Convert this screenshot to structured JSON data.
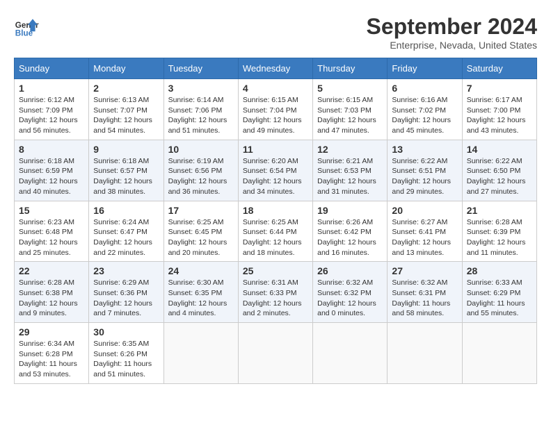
{
  "header": {
    "title": "September 2024",
    "subtitle": "Enterprise, Nevada, United States",
    "logo_line1": "General",
    "logo_line2": "Blue"
  },
  "days_of_week": [
    "Sunday",
    "Monday",
    "Tuesday",
    "Wednesday",
    "Thursday",
    "Friday",
    "Saturday"
  ],
  "weeks": [
    [
      {
        "day": "1",
        "info": "Sunrise: 6:12 AM\nSunset: 7:09 PM\nDaylight: 12 hours\nand 56 minutes."
      },
      {
        "day": "2",
        "info": "Sunrise: 6:13 AM\nSunset: 7:07 PM\nDaylight: 12 hours\nand 54 minutes."
      },
      {
        "day": "3",
        "info": "Sunrise: 6:14 AM\nSunset: 7:06 PM\nDaylight: 12 hours\nand 51 minutes."
      },
      {
        "day": "4",
        "info": "Sunrise: 6:15 AM\nSunset: 7:04 PM\nDaylight: 12 hours\nand 49 minutes."
      },
      {
        "day": "5",
        "info": "Sunrise: 6:15 AM\nSunset: 7:03 PM\nDaylight: 12 hours\nand 47 minutes."
      },
      {
        "day": "6",
        "info": "Sunrise: 6:16 AM\nSunset: 7:02 PM\nDaylight: 12 hours\nand 45 minutes."
      },
      {
        "day": "7",
        "info": "Sunrise: 6:17 AM\nSunset: 7:00 PM\nDaylight: 12 hours\nand 43 minutes."
      }
    ],
    [
      {
        "day": "8",
        "info": "Sunrise: 6:18 AM\nSunset: 6:59 PM\nDaylight: 12 hours\nand 40 minutes."
      },
      {
        "day": "9",
        "info": "Sunrise: 6:18 AM\nSunset: 6:57 PM\nDaylight: 12 hours\nand 38 minutes."
      },
      {
        "day": "10",
        "info": "Sunrise: 6:19 AM\nSunset: 6:56 PM\nDaylight: 12 hours\nand 36 minutes."
      },
      {
        "day": "11",
        "info": "Sunrise: 6:20 AM\nSunset: 6:54 PM\nDaylight: 12 hours\nand 34 minutes."
      },
      {
        "day": "12",
        "info": "Sunrise: 6:21 AM\nSunset: 6:53 PM\nDaylight: 12 hours\nand 31 minutes."
      },
      {
        "day": "13",
        "info": "Sunrise: 6:22 AM\nSunset: 6:51 PM\nDaylight: 12 hours\nand 29 minutes."
      },
      {
        "day": "14",
        "info": "Sunrise: 6:22 AM\nSunset: 6:50 PM\nDaylight: 12 hours\nand 27 minutes."
      }
    ],
    [
      {
        "day": "15",
        "info": "Sunrise: 6:23 AM\nSunset: 6:48 PM\nDaylight: 12 hours\nand 25 minutes."
      },
      {
        "day": "16",
        "info": "Sunrise: 6:24 AM\nSunset: 6:47 PM\nDaylight: 12 hours\nand 22 minutes."
      },
      {
        "day": "17",
        "info": "Sunrise: 6:25 AM\nSunset: 6:45 PM\nDaylight: 12 hours\nand 20 minutes."
      },
      {
        "day": "18",
        "info": "Sunrise: 6:25 AM\nSunset: 6:44 PM\nDaylight: 12 hours\nand 18 minutes."
      },
      {
        "day": "19",
        "info": "Sunrise: 6:26 AM\nSunset: 6:42 PM\nDaylight: 12 hours\nand 16 minutes."
      },
      {
        "day": "20",
        "info": "Sunrise: 6:27 AM\nSunset: 6:41 PM\nDaylight: 12 hours\nand 13 minutes."
      },
      {
        "day": "21",
        "info": "Sunrise: 6:28 AM\nSunset: 6:39 PM\nDaylight: 12 hours\nand 11 minutes."
      }
    ],
    [
      {
        "day": "22",
        "info": "Sunrise: 6:28 AM\nSunset: 6:38 PM\nDaylight: 12 hours\nand 9 minutes."
      },
      {
        "day": "23",
        "info": "Sunrise: 6:29 AM\nSunset: 6:36 PM\nDaylight: 12 hours\nand 7 minutes."
      },
      {
        "day": "24",
        "info": "Sunrise: 6:30 AM\nSunset: 6:35 PM\nDaylight: 12 hours\nand 4 minutes."
      },
      {
        "day": "25",
        "info": "Sunrise: 6:31 AM\nSunset: 6:33 PM\nDaylight: 12 hours\nand 2 minutes."
      },
      {
        "day": "26",
        "info": "Sunrise: 6:32 AM\nSunset: 6:32 PM\nDaylight: 12 hours\nand 0 minutes."
      },
      {
        "day": "27",
        "info": "Sunrise: 6:32 AM\nSunset: 6:31 PM\nDaylight: 11 hours\nand 58 minutes."
      },
      {
        "day": "28",
        "info": "Sunrise: 6:33 AM\nSunset: 6:29 PM\nDaylight: 11 hours\nand 55 minutes."
      }
    ],
    [
      {
        "day": "29",
        "info": "Sunrise: 6:34 AM\nSunset: 6:28 PM\nDaylight: 11 hours\nand 53 minutes."
      },
      {
        "day": "30",
        "info": "Sunrise: 6:35 AM\nSunset: 6:26 PM\nDaylight: 11 hours\nand 51 minutes."
      },
      {
        "day": "",
        "info": ""
      },
      {
        "day": "",
        "info": ""
      },
      {
        "day": "",
        "info": ""
      },
      {
        "day": "",
        "info": ""
      },
      {
        "day": "",
        "info": ""
      }
    ]
  ]
}
